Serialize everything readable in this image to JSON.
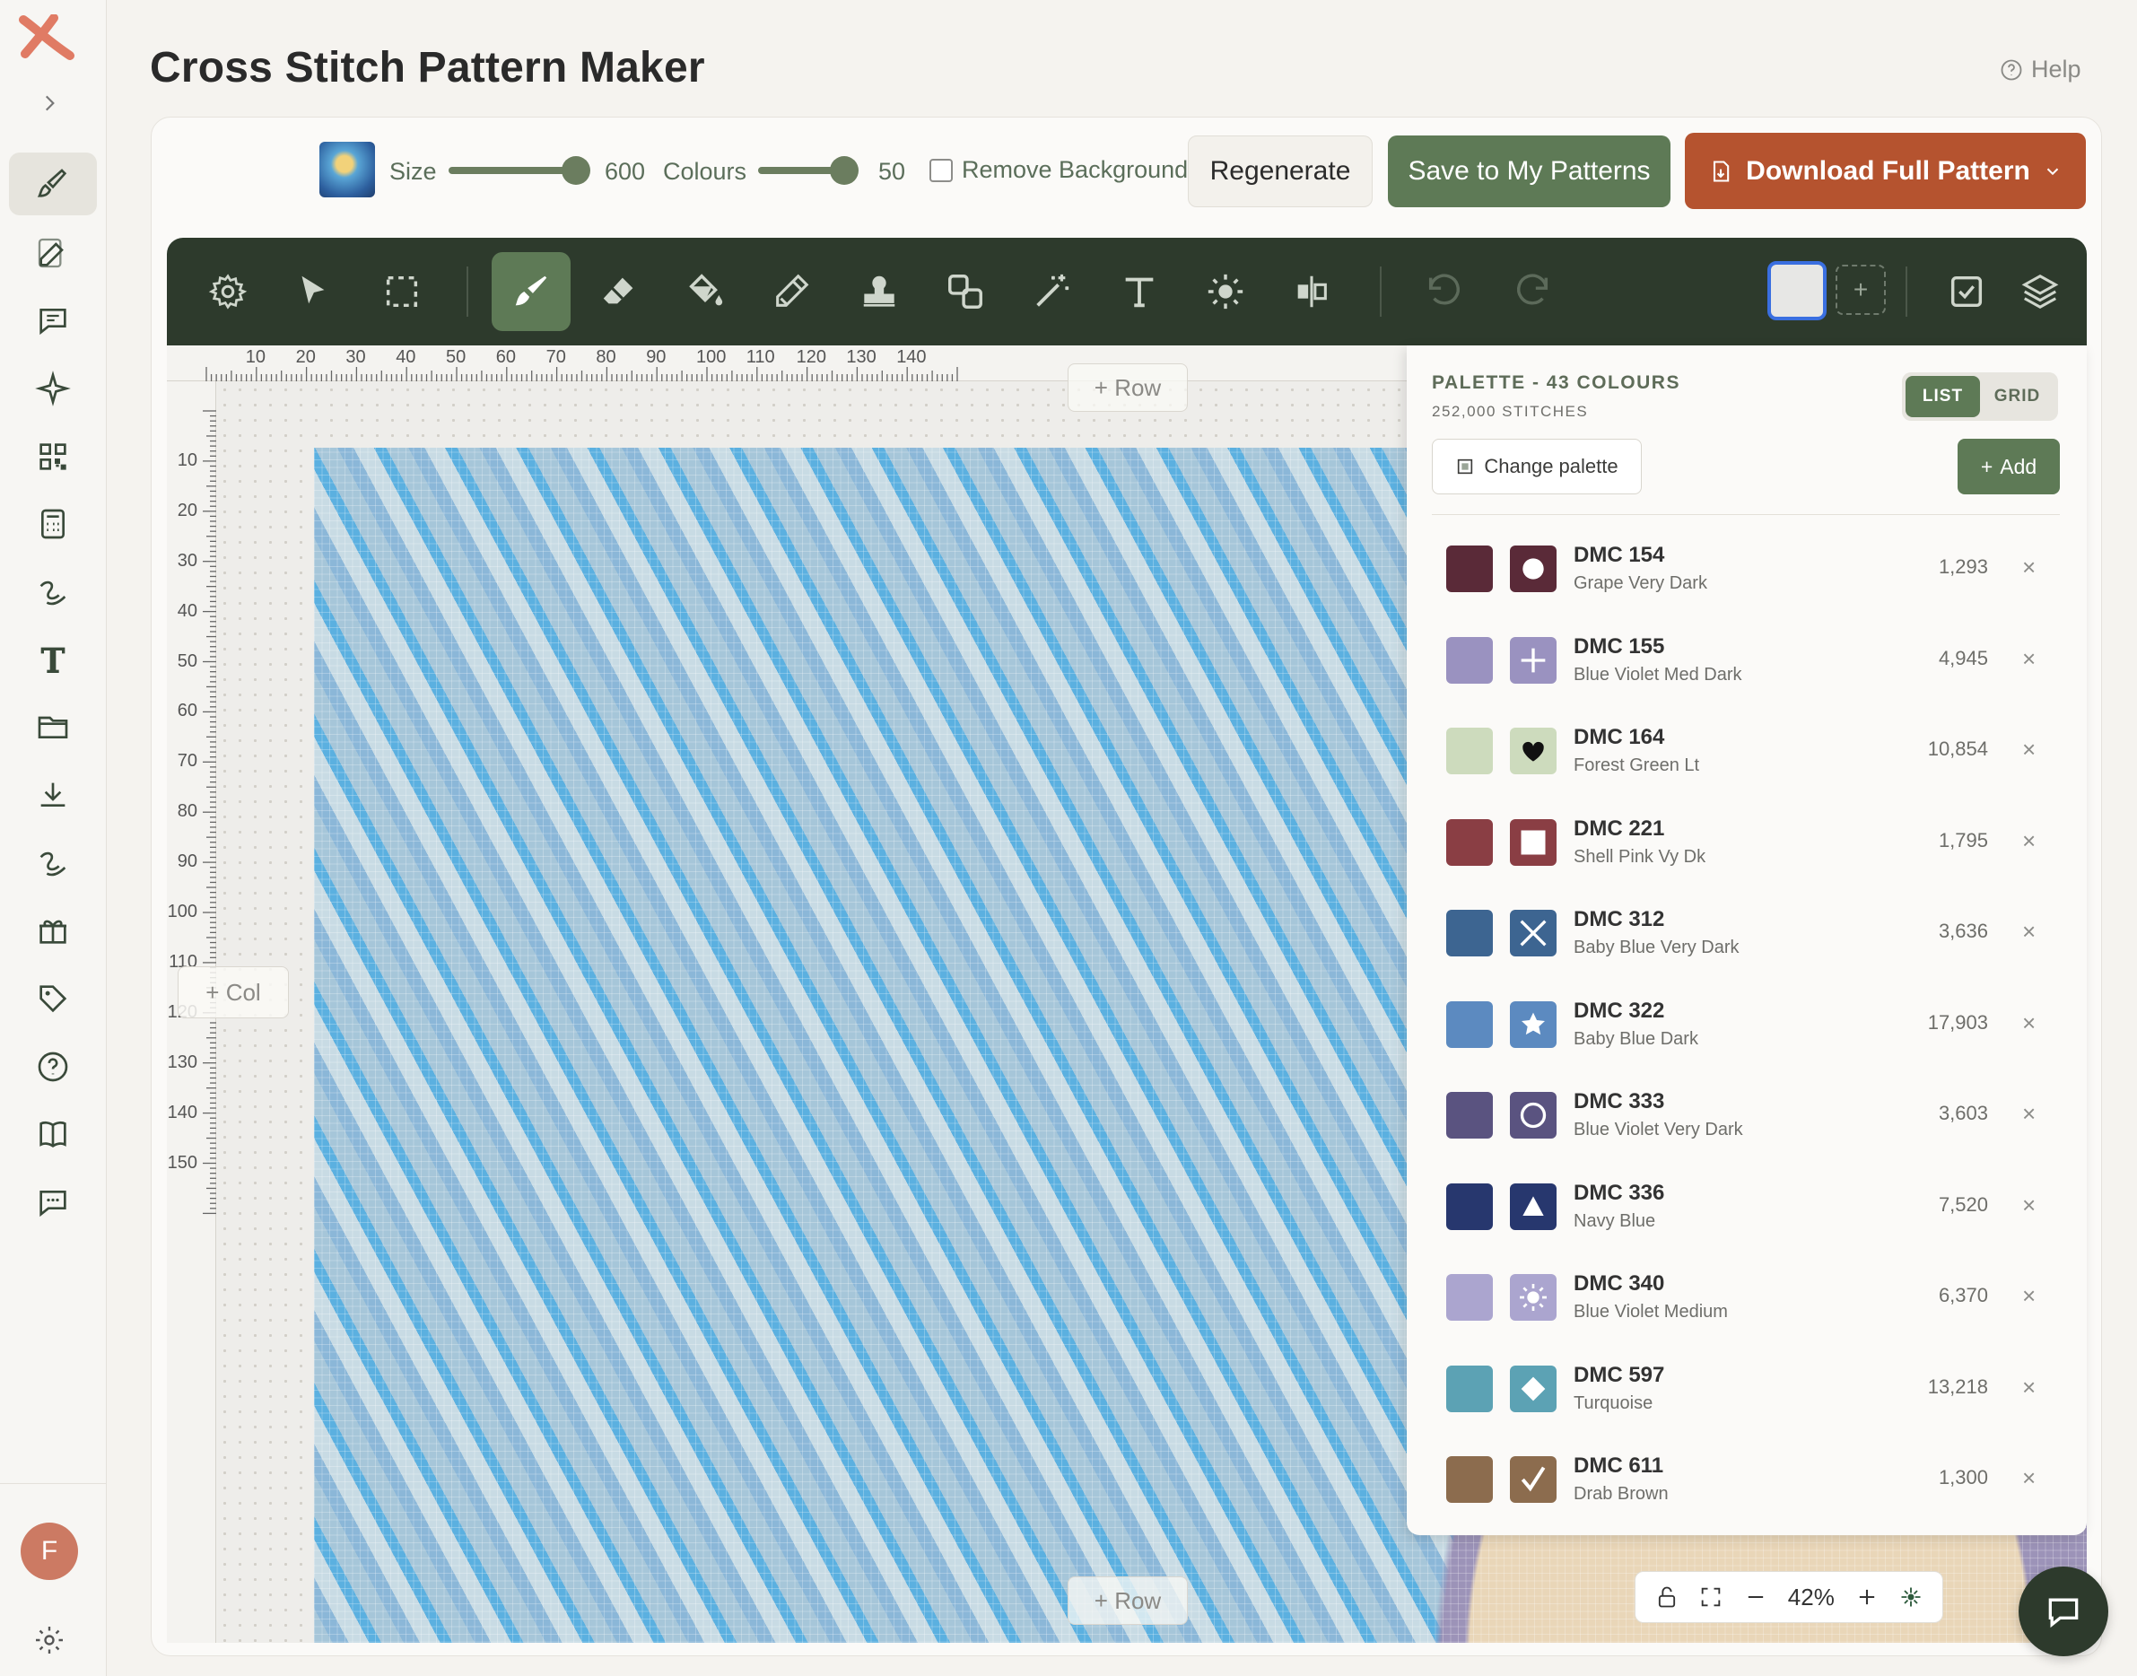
{
  "app": {
    "title": "Cross Stitch Pattern Maker",
    "help": "Help",
    "user_initial": "F"
  },
  "options": {
    "size_label": "Size",
    "size_value": "600",
    "size_fraction": 1.0,
    "colours_label": "Colours",
    "colours_value": "50",
    "colours_fraction": 1.0,
    "remove_bg_label": "Remove Background",
    "remove_bg_checked": false,
    "regenerate": "Regenerate",
    "save": "Save to My Patterns",
    "download": "Download Full Pattern"
  },
  "toolbar": {
    "tools": [
      "settings-icon",
      "select-icon",
      "marquee-icon",
      "brush-icon",
      "eraser-icon",
      "fill-icon",
      "eyedropper-icon",
      "stamp-icon",
      "shapes-icon",
      "magic-wand-icon",
      "text-icon",
      "brightness-icon",
      "mirror-icon"
    ],
    "active_tool": "brush-icon",
    "current_color": "#e7e7e5"
  },
  "canvas": {
    "ruler_top": [
      "10",
      "20",
      "30",
      "40",
      "50",
      "60",
      "70",
      "80",
      "90",
      "100",
      "110",
      "120",
      "130",
      "140"
    ],
    "ruler_left": [
      "10",
      "20",
      "30",
      "40",
      "50",
      "60",
      "70",
      "80",
      "90",
      "100",
      "110",
      "120",
      "130",
      "140",
      "150"
    ],
    "add_row": "+ Row",
    "add_col": "+ Col",
    "zoom": "42%"
  },
  "palette": {
    "title": "PALETTE - 43 COLOURS",
    "stitches": "252,000 STITCHES",
    "view_list": "LIST",
    "view_grid": "GRID",
    "change_palette": "Change palette",
    "add": "Add",
    "items": [
      {
        "code": "DMC 154",
        "name": "Grape Very Dark",
        "count": "1,293",
        "color": "#5a2a38",
        "symbol": "circle-filled"
      },
      {
        "code": "DMC 155",
        "name": "Blue Violet Med Dark",
        "count": "4,945",
        "color": "#9a92c0",
        "symbol": "plus"
      },
      {
        "code": "DMC 164",
        "name": "Forest Green Lt",
        "count": "10,854",
        "color": "#cddbbd",
        "symbol": "heart"
      },
      {
        "code": "DMC 221",
        "name": "Shell Pink Vy Dk",
        "count": "1,795",
        "color": "#8a3e44",
        "symbol": "square-outline"
      },
      {
        "code": "DMC 312",
        "name": "Baby Blue Very Dark",
        "count": "3,636",
        "color": "#3d6591",
        "symbol": "x-mark"
      },
      {
        "code": "DMC 322",
        "name": "Baby Blue Dark",
        "count": "17,903",
        "color": "#5c8ac0",
        "symbol": "star"
      },
      {
        "code": "DMC 333",
        "name": "Blue Violet Very Dark",
        "count": "3,603",
        "color": "#5a5380",
        "symbol": "circle-outline"
      },
      {
        "code": "DMC 336",
        "name": "Navy Blue",
        "count": "7,520",
        "color": "#27376e",
        "symbol": "triangle"
      },
      {
        "code": "DMC 340",
        "name": "Blue Violet Medium",
        "count": "6,370",
        "color": "#aba5cf",
        "symbol": "sun"
      },
      {
        "code": "DMC 597",
        "name": "Turquoise",
        "count": "13,218",
        "color": "#5ca2b4",
        "symbol": "diamond"
      },
      {
        "code": "DMC 611",
        "name": "Drab Brown",
        "count": "1,300",
        "color": "#8c6c4e",
        "symbol": "check"
      }
    ]
  }
}
